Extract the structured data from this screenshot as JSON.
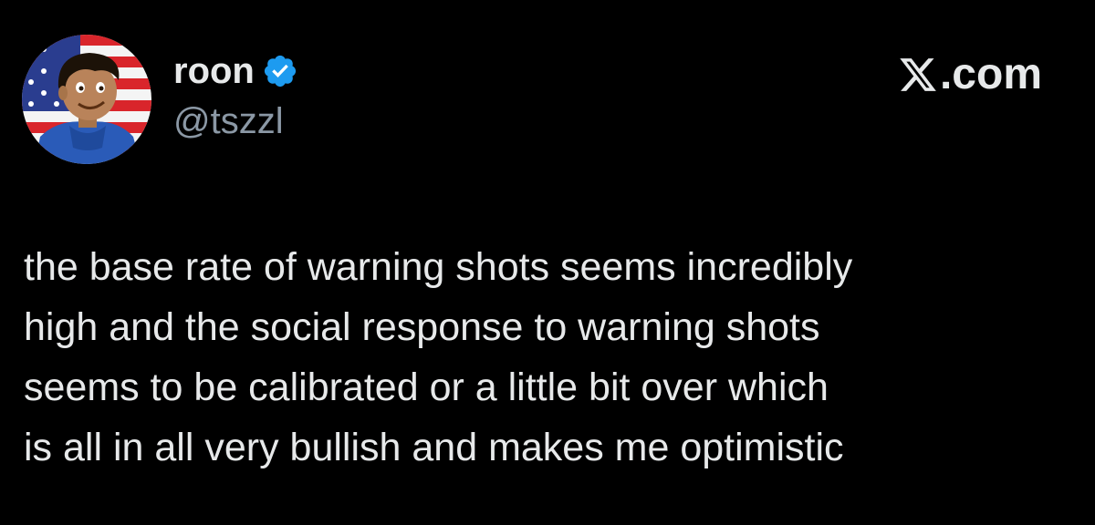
{
  "author": {
    "display_name": "roon",
    "handle": "@tszzl",
    "verified": true,
    "avatar_icon": "cartoon-boy-flag-avatar"
  },
  "brand": {
    "icon": "x-logo-icon",
    "suffix": ".com"
  },
  "tweet": {
    "lines": [
      "the base rate of warning shots seems incredibly",
      "high and the social response to warning shots",
      "seems to be calibrated or a little bit over which",
      "is all in all very bullish and makes me optimistic"
    ]
  },
  "colors": {
    "background": "#000000",
    "text": "#e7e9ea",
    "muted": "#8b98a5",
    "verified_badge": "#1d9bf0"
  }
}
